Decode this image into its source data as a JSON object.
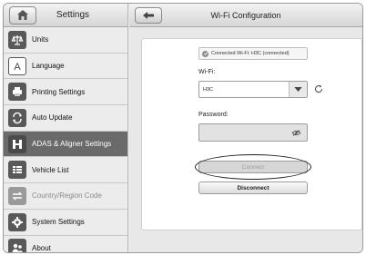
{
  "sidebar": {
    "title": "Settings",
    "items": [
      {
        "label": "Units",
        "icon": "scale-icon",
        "active": false,
        "disabled": false
      },
      {
        "label": "Language",
        "icon": "language-icon",
        "active": false,
        "disabled": false
      },
      {
        "label": "Printing Settings",
        "icon": "printer-icon",
        "active": false,
        "disabled": false
      },
      {
        "label": "Auto Update",
        "icon": "update-icon",
        "active": false,
        "disabled": false
      },
      {
        "label": "ADAS & Aligner Settings",
        "icon": "aligner-icon",
        "active": true,
        "disabled": false
      },
      {
        "label": "Vehicle List",
        "icon": "vehicle-list-icon",
        "active": false,
        "disabled": false
      },
      {
        "label": "Country/Region Code",
        "icon": "region-icon",
        "active": false,
        "disabled": true
      },
      {
        "label": "System Settings",
        "icon": "gear-icon",
        "active": false,
        "disabled": false
      },
      {
        "label": "About",
        "icon": "about-icon",
        "active": false,
        "disabled": false
      }
    ]
  },
  "main": {
    "title": "Wi-Fi Configuration",
    "status_text": "Connected Wi-Fi: H3C (connected)",
    "wifi_label": "Wi-Fi:",
    "wifi_value": "H3C",
    "password_label": "Password:",
    "connect_label": "Connect",
    "disconnect_label": "Disconnect"
  },
  "colors": {
    "active_item": "#6a6a6a",
    "panel": "#ffffff",
    "background": "#e8e8e8"
  }
}
